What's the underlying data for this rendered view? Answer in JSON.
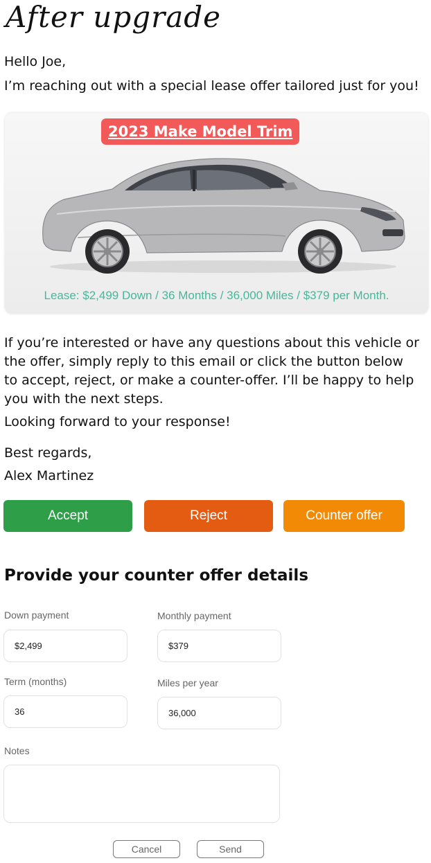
{
  "header": {
    "title": "After upgrade"
  },
  "email": {
    "greeting": "Hello Joe,",
    "intro": "I’m reaching out with a special lease offer tailored just for you!",
    "body": "If you’re interested or have any questions about this vehicle or the offer, simply reply to this email or click the button below to accept, reject, or make a counter-offer. I’ll be happy to help you with the next steps.",
    "closing_line": "Looking forward to your response!",
    "signoff": "Best regards,",
    "sender": "Alex Martinez"
  },
  "offer_card": {
    "vehicle_title": "2023 Make Model Trim",
    "lease_text": "Lease: $2,499 Down / 36 Months / 36,000 Miles / $379 per Month.",
    "car_color": "#b9b9bb",
    "badge_color": "#f25a5a",
    "lease_color": "#43b99a"
  },
  "actions": {
    "accept_label": "Accept",
    "reject_label": "Reject",
    "counter_label": "Counter offer",
    "accept_color": "#2f9e48",
    "reject_color": "#e45c12",
    "counter_color": "#f28a06"
  },
  "counter_form": {
    "title": "Provide your counter offer details",
    "down_payment": {
      "label": "Down payment",
      "value": "$2,499"
    },
    "monthly_payment": {
      "label": "Monthly payment",
      "value": "$379"
    },
    "term": {
      "label": "Term (months)",
      "value": "36"
    },
    "miles": {
      "label": "Miles per year",
      "value": "36,000"
    },
    "notes": {
      "label": "Notes",
      "value": ""
    },
    "cancel_label": "Cancel",
    "send_label": "Send"
  }
}
